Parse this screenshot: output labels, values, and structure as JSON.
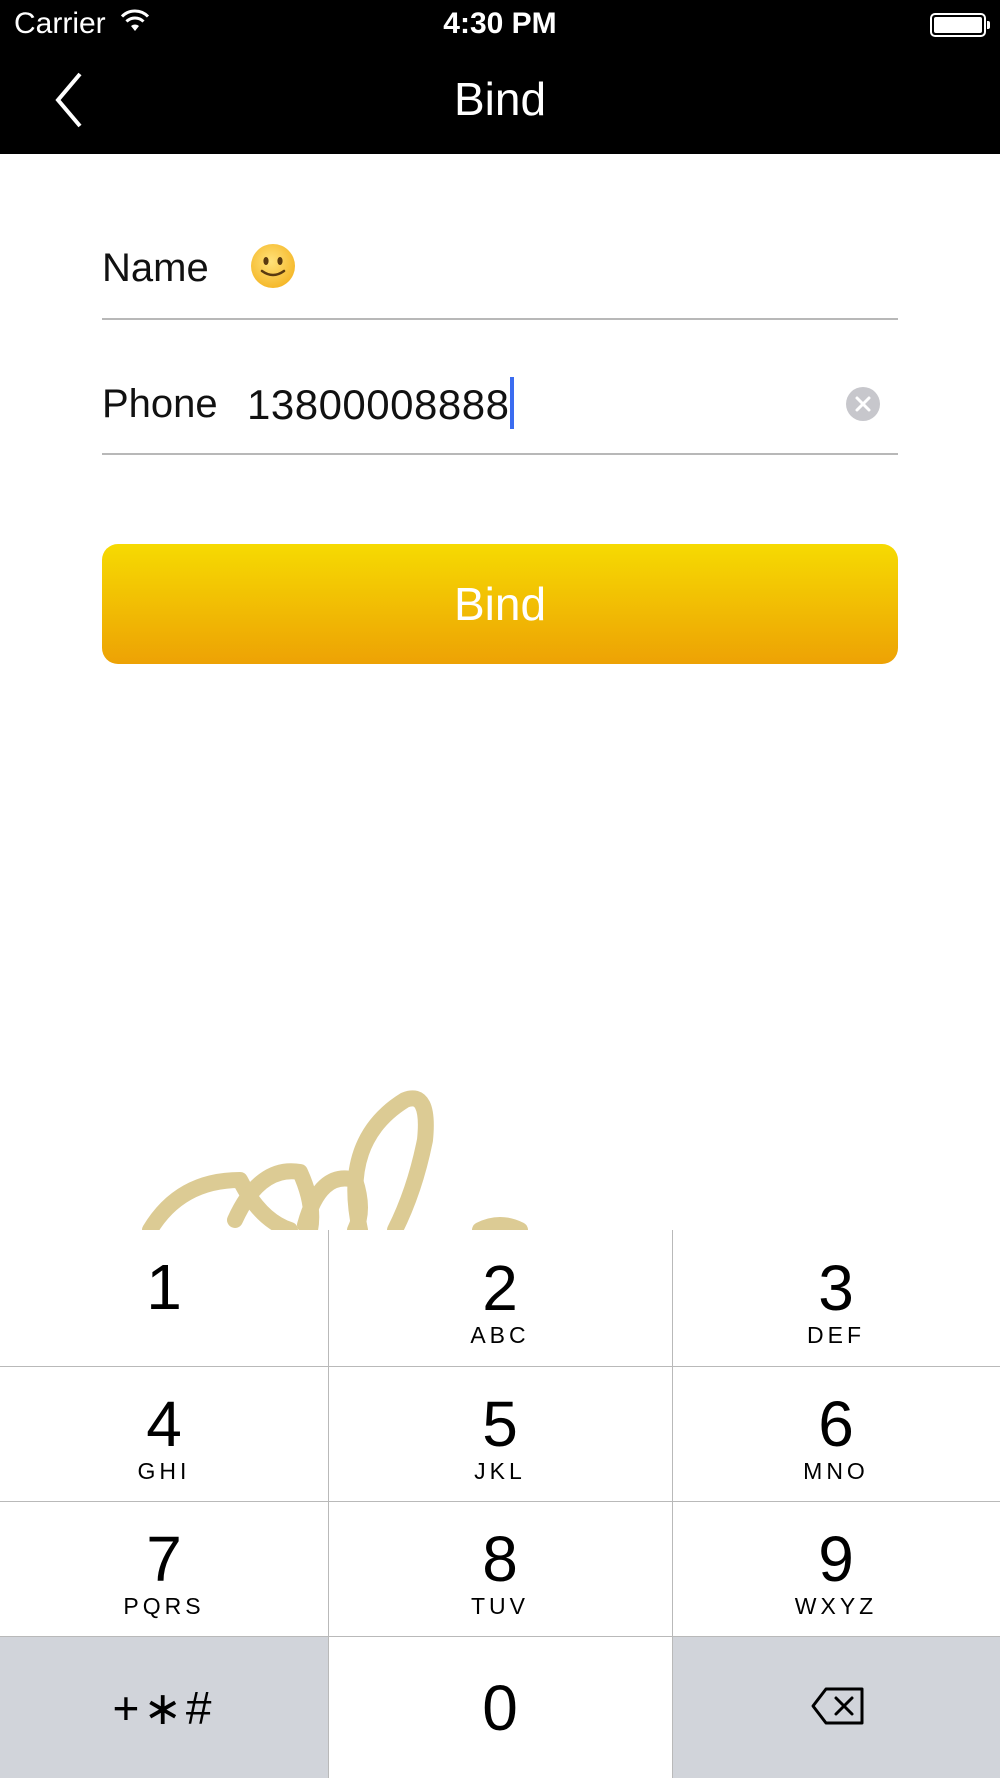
{
  "status_bar": {
    "carrier": "Carrier",
    "time": "4:30 PM"
  },
  "nav": {
    "title": "Bind"
  },
  "form": {
    "name_label": "Name",
    "name_value": "🙂",
    "phone_label": "Phone",
    "phone_value": "13800008888"
  },
  "bind_button": {
    "label": "Bind"
  },
  "keypad": {
    "keys": [
      {
        "digit": "1",
        "letters": ""
      },
      {
        "digit": "2",
        "letters": "ABC"
      },
      {
        "digit": "3",
        "letters": "DEF"
      },
      {
        "digit": "4",
        "letters": "GHI"
      },
      {
        "digit": "5",
        "letters": "JKL"
      },
      {
        "digit": "6",
        "letters": "MNO"
      },
      {
        "digit": "7",
        "letters": "PQRS"
      },
      {
        "digit": "8",
        "letters": "TUV"
      },
      {
        "digit": "9",
        "letters": "WXYZ"
      },
      {
        "digit": "+∗#",
        "letters": ""
      },
      {
        "digit": "0",
        "letters": ""
      }
    ]
  },
  "colors": {
    "nav_background": "#000000",
    "button_gradient_top": "#f6da02",
    "button_gradient_bottom": "#eda205",
    "caret": "#3b6cf0",
    "keypad_dark_key": "#d1d4da"
  }
}
